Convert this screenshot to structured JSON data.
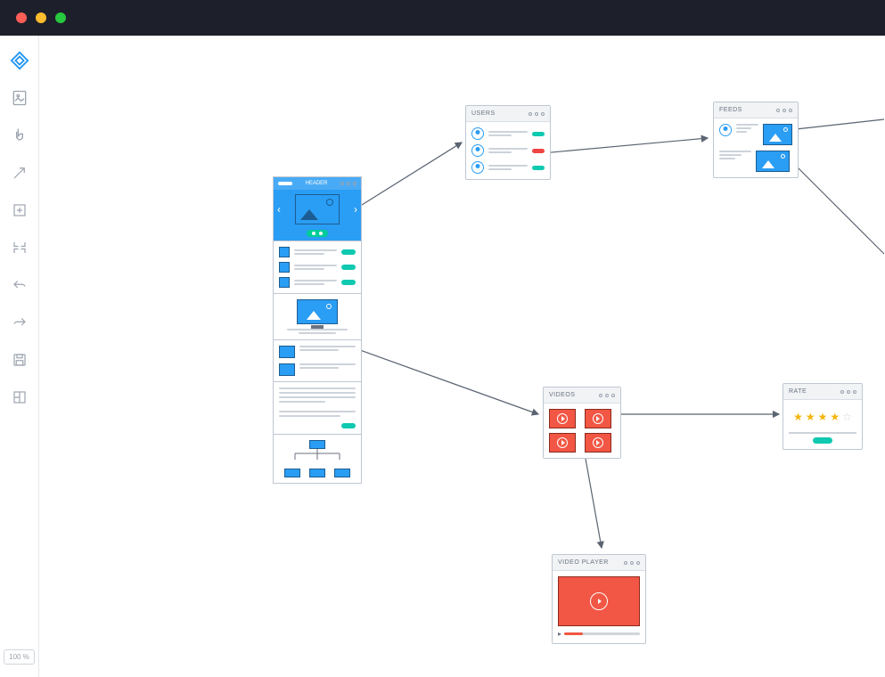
{
  "window": {
    "traffic_lights": [
      "red",
      "yellow",
      "green"
    ]
  },
  "toolbar": {
    "items": [
      {
        "name": "wireframe-tool",
        "active": true
      },
      {
        "name": "page-tool",
        "active": false
      },
      {
        "name": "pointer-tool",
        "active": false
      },
      {
        "name": "arrow-tool",
        "active": false
      },
      {
        "name": "add-frame-tool",
        "active": false
      },
      {
        "name": "crop-tool",
        "active": false
      },
      {
        "name": "undo-tool",
        "active": false
      },
      {
        "name": "redo-tool",
        "active": false
      },
      {
        "name": "save-tool",
        "active": false
      },
      {
        "name": "layout-tool",
        "active": false
      }
    ],
    "zoom_label": "100 %"
  },
  "canvas": {
    "main_page": {
      "hero_title": "HEADER",
      "sections": [
        "hero",
        "list",
        "monitor",
        "thumbs",
        "text",
        "sitemap"
      ]
    },
    "users": {
      "title": "USERS",
      "rows": [
        {
          "tag": "green"
        },
        {
          "tag": "red"
        },
        {
          "tag": "green"
        }
      ]
    },
    "feeds": {
      "title": "FEEDS",
      "rows": 2
    },
    "videos": {
      "title": "VIDEOS",
      "count": 4
    },
    "rate": {
      "title": "RATE",
      "stars_filled": 4,
      "stars_total": 5
    },
    "video_player": {
      "title": "VIDEO PLAYER"
    },
    "connections": [
      {
        "from": "main-hero",
        "to": "users"
      },
      {
        "from": "users",
        "to": "feeds"
      },
      {
        "from": "feeds",
        "to": "offscreen-right-1"
      },
      {
        "from": "feeds",
        "to": "offscreen-right-2"
      },
      {
        "from": "main-monitor",
        "to": "videos"
      },
      {
        "from": "videos",
        "to": "rate"
      },
      {
        "from": "videos",
        "to": "video-player"
      }
    ]
  }
}
